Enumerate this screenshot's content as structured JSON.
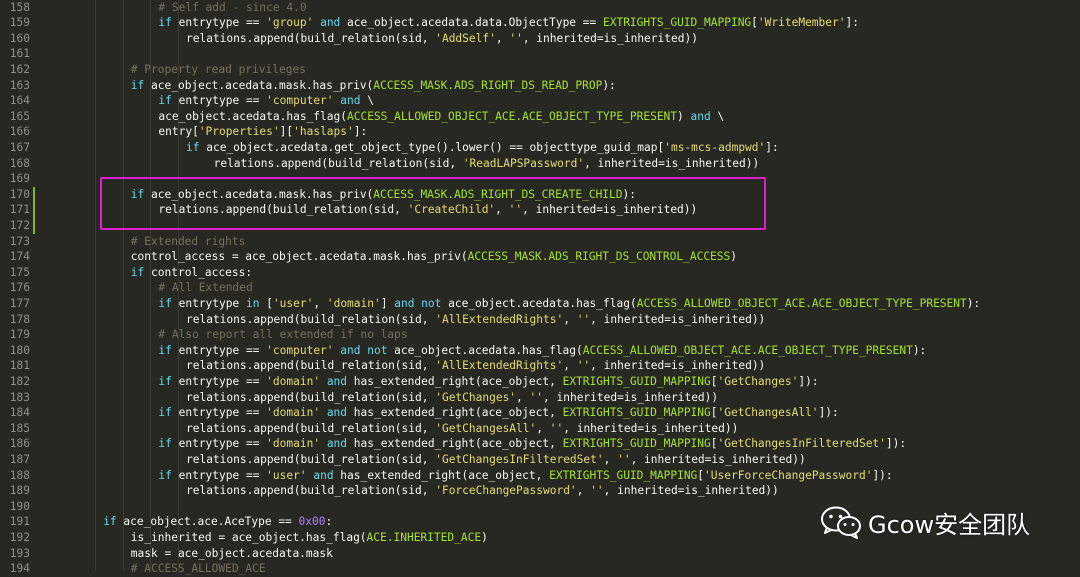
{
  "editor": {
    "lines": [
      {
        "n": "158",
        "i": 4,
        "t": [
          [
            "cm",
            "# Self add - since 4.0"
          ]
        ]
      },
      {
        "n": "159",
        "i": 4,
        "t": [
          [
            "kw",
            "if"
          ],
          [
            "pl",
            " entrytype == "
          ],
          [
            "st",
            "'group'"
          ],
          [
            "pl",
            " "
          ],
          [
            "kw",
            "and"
          ],
          [
            "pl",
            " ace_object.acedata.data.ObjectType == "
          ],
          [
            "cn",
            "EXTRIGHTS_GUID_MAPPING"
          ],
          [
            "pl",
            "["
          ],
          [
            "st",
            "'WriteMember'"
          ],
          [
            "pl",
            "]:"
          ]
        ]
      },
      {
        "n": "160",
        "i": 5,
        "t": [
          [
            "pl",
            "relations.append(build_relation(sid, "
          ],
          [
            "st",
            "'AddSelf'"
          ],
          [
            "pl",
            ", "
          ],
          [
            "st",
            "''"
          ],
          [
            "pl",
            ", inherited=is_inherited))"
          ]
        ]
      },
      {
        "n": "161",
        "i": 0,
        "t": []
      },
      {
        "n": "162",
        "i": 3,
        "t": [
          [
            "cm",
            "# Property read privileges"
          ]
        ]
      },
      {
        "n": "163",
        "i": 3,
        "t": [
          [
            "kw",
            "if"
          ],
          [
            "pl",
            " ace_object.acedata.mask.has_priv("
          ],
          [
            "cn",
            "ACCESS_MASK.ADS_RIGHT_DS_READ_PROP"
          ],
          [
            "pl",
            "):"
          ]
        ]
      },
      {
        "n": "164",
        "i": 4,
        "t": [
          [
            "kw",
            "if"
          ],
          [
            "pl",
            " entrytype == "
          ],
          [
            "st",
            "'computer'"
          ],
          [
            "pl",
            " "
          ],
          [
            "kw",
            "and"
          ],
          [
            "pl",
            " \\"
          ]
        ]
      },
      {
        "n": "165",
        "i": 4,
        "t": [
          [
            "pl",
            "ace_object.acedata.has_flag("
          ],
          [
            "cn",
            "ACCESS_ALLOWED_OBJECT_ACE.ACE_OBJECT_TYPE_PRESENT"
          ],
          [
            "pl",
            ") "
          ],
          [
            "kw",
            "and"
          ],
          [
            "pl",
            " \\"
          ]
        ]
      },
      {
        "n": "166",
        "i": 4,
        "t": [
          [
            "pl",
            "entry["
          ],
          [
            "st",
            "'Properties'"
          ],
          [
            "pl",
            "]["
          ],
          [
            "st",
            "'haslaps'"
          ],
          [
            "pl",
            "]:"
          ]
        ]
      },
      {
        "n": "167",
        "i": 5,
        "t": [
          [
            "kw",
            "if"
          ],
          [
            "pl",
            " ace_object.acedata.get_object_type().lower() == objecttype_guid_map["
          ],
          [
            "st",
            "'ms-mcs-admpwd'"
          ],
          [
            "pl",
            "]:"
          ]
        ]
      },
      {
        "n": "168",
        "i": 6,
        "t": [
          [
            "pl",
            "relations.append(build_relation(sid, "
          ],
          [
            "st",
            "'ReadLAPSPassword'"
          ],
          [
            "pl",
            ", inherited=is_inherited))"
          ]
        ]
      },
      {
        "n": "169",
        "i": 0,
        "t": []
      },
      {
        "n": "170",
        "i": 3,
        "t": [
          [
            "kw",
            "if"
          ],
          [
            "pl",
            " ace_object.acedata.mask.has_priv("
          ],
          [
            "cn",
            "ACCESS_MASK.ADS_RIGHT_DS_CREATE_CHILD"
          ],
          [
            "pl",
            "):"
          ]
        ]
      },
      {
        "n": "171",
        "i": 4,
        "t": [
          [
            "pl",
            "relations.append(build_relation(sid, "
          ],
          [
            "st",
            "'CreateChild'"
          ],
          [
            "pl",
            ", "
          ],
          [
            "st",
            "''"
          ],
          [
            "pl",
            ", inherited=is_inherited))"
          ]
        ]
      },
      {
        "n": "172",
        "i": 0,
        "t": []
      },
      {
        "n": "173",
        "i": 3,
        "t": [
          [
            "cm",
            "# Extended rights"
          ]
        ]
      },
      {
        "n": "174",
        "i": 3,
        "t": [
          [
            "pl",
            "control_access = ace_object.acedata.mask.has_priv("
          ],
          [
            "cn",
            "ACCESS_MASK.ADS_RIGHT_DS_CONTROL_ACCESS"
          ],
          [
            "pl",
            ")"
          ]
        ]
      },
      {
        "n": "175",
        "i": 3,
        "t": [
          [
            "kw",
            "if"
          ],
          [
            "pl",
            " control_access:"
          ]
        ]
      },
      {
        "n": "176",
        "i": 4,
        "t": [
          [
            "cm",
            "# All Extended"
          ]
        ]
      },
      {
        "n": "177",
        "i": 4,
        "t": [
          [
            "kw",
            "if"
          ],
          [
            "pl",
            " entrytype "
          ],
          [
            "kw",
            "in"
          ],
          [
            "pl",
            " ["
          ],
          [
            "st",
            "'user'"
          ],
          [
            "pl",
            ", "
          ],
          [
            "st",
            "'domain'"
          ],
          [
            "pl",
            "] "
          ],
          [
            "kw",
            "and not"
          ],
          [
            "pl",
            " ace_object.acedata.has_flag("
          ],
          [
            "cn",
            "ACCESS_ALLOWED_OBJECT_ACE.ACE_OBJECT_TYPE_PRESENT"
          ],
          [
            "pl",
            "):"
          ]
        ]
      },
      {
        "n": "178",
        "i": 5,
        "t": [
          [
            "pl",
            "relations.append(build_relation(sid, "
          ],
          [
            "st",
            "'AllExtendedRights'"
          ],
          [
            "pl",
            ", "
          ],
          [
            "st",
            "''"
          ],
          [
            "pl",
            ", inherited=is_inherited))"
          ]
        ]
      },
      {
        "n": "179",
        "i": 4,
        "t": [
          [
            "cm",
            "# Also report all extended if no laps"
          ]
        ]
      },
      {
        "n": "180",
        "i": 4,
        "t": [
          [
            "kw",
            "if"
          ],
          [
            "pl",
            " entrytype == "
          ],
          [
            "st",
            "'computer'"
          ],
          [
            "pl",
            " "
          ],
          [
            "kw",
            "and not"
          ],
          [
            "pl",
            " ace_object.acedata.has_flag("
          ],
          [
            "cn",
            "ACCESS_ALLOWED_OBJECT_ACE.ACE_OBJECT_TYPE_PRESENT"
          ],
          [
            "pl",
            "):"
          ]
        ]
      },
      {
        "n": "181",
        "i": 5,
        "t": [
          [
            "pl",
            "relations.append(build_relation(sid, "
          ],
          [
            "st",
            "'AllExtendedRights'"
          ],
          [
            "pl",
            ", "
          ],
          [
            "st",
            "''"
          ],
          [
            "pl",
            ", inherited=is_inherited))"
          ]
        ]
      },
      {
        "n": "182",
        "i": 4,
        "t": [
          [
            "kw",
            "if"
          ],
          [
            "pl",
            " entrytype == "
          ],
          [
            "st",
            "'domain'"
          ],
          [
            "pl",
            " "
          ],
          [
            "kw",
            "and"
          ],
          [
            "pl",
            " has_extended_right(ace_object, "
          ],
          [
            "cn",
            "EXTRIGHTS_GUID_MAPPING"
          ],
          [
            "pl",
            "["
          ],
          [
            "st",
            "'GetChanges'"
          ],
          [
            "pl",
            "]):"
          ]
        ]
      },
      {
        "n": "183",
        "i": 5,
        "t": [
          [
            "pl",
            "relations.append(build_relation(sid, "
          ],
          [
            "st",
            "'GetChanges'"
          ],
          [
            "pl",
            ", "
          ],
          [
            "st",
            "''"
          ],
          [
            "pl",
            ", inherited=is_inherited))"
          ]
        ]
      },
      {
        "n": "184",
        "i": 4,
        "t": [
          [
            "kw",
            "if"
          ],
          [
            "pl",
            " entrytype == "
          ],
          [
            "st",
            "'domain'"
          ],
          [
            "pl",
            " "
          ],
          [
            "kw",
            "and"
          ],
          [
            "pl",
            " has_extended_right(ace_object, "
          ],
          [
            "cn",
            "EXTRIGHTS_GUID_MAPPING"
          ],
          [
            "pl",
            "["
          ],
          [
            "st",
            "'GetChangesAll'"
          ],
          [
            "pl",
            "]):"
          ]
        ]
      },
      {
        "n": "185",
        "i": 5,
        "t": [
          [
            "pl",
            "relations.append(build_relation(sid, "
          ],
          [
            "st",
            "'GetChangesAll'"
          ],
          [
            "pl",
            ", "
          ],
          [
            "st",
            "''"
          ],
          [
            "pl",
            ", inherited=is_inherited))"
          ]
        ]
      },
      {
        "n": "186",
        "i": 4,
        "t": [
          [
            "kw",
            "if"
          ],
          [
            "pl",
            " entrytype == "
          ],
          [
            "st",
            "'domain'"
          ],
          [
            "pl",
            " "
          ],
          [
            "kw",
            "and"
          ],
          [
            "pl",
            " has_extended_right(ace_object, "
          ],
          [
            "cn",
            "EXTRIGHTS_GUID_MAPPING"
          ],
          [
            "pl",
            "["
          ],
          [
            "st",
            "'GetChangesInFilteredSet'"
          ],
          [
            "pl",
            "]):"
          ]
        ]
      },
      {
        "n": "187",
        "i": 5,
        "t": [
          [
            "pl",
            "relations.append(build_relation(sid, "
          ],
          [
            "st",
            "'GetChangesInFilteredSet'"
          ],
          [
            "pl",
            ", "
          ],
          [
            "st",
            "''"
          ],
          [
            "pl",
            ", inherited=is_inherited))"
          ]
        ]
      },
      {
        "n": "188",
        "i": 4,
        "t": [
          [
            "kw",
            "if"
          ],
          [
            "pl",
            " entrytype == "
          ],
          [
            "st",
            "'user'"
          ],
          [
            "pl",
            " "
          ],
          [
            "kw",
            "and"
          ],
          [
            "pl",
            " has_extended_right(ace_object, "
          ],
          [
            "cn",
            "EXTRIGHTS_GUID_MAPPING"
          ],
          [
            "pl",
            "["
          ],
          [
            "st",
            "'UserForceChangePassword'"
          ],
          [
            "pl",
            "]):"
          ]
        ]
      },
      {
        "n": "189",
        "i": 5,
        "t": [
          [
            "pl",
            "relations.append(build_relation(sid, "
          ],
          [
            "st",
            "'ForceChangePassword'"
          ],
          [
            "pl",
            ", "
          ],
          [
            "st",
            "''"
          ],
          [
            "pl",
            ", inherited=is_inherited))"
          ]
        ]
      },
      {
        "n": "190",
        "i": 0,
        "t": []
      },
      {
        "n": "191",
        "i": 2,
        "t": [
          [
            "kw",
            "if"
          ],
          [
            "pl",
            " ace_object.ace.AceType == "
          ],
          [
            "nm",
            "0x00"
          ],
          [
            "pl",
            ":"
          ]
        ]
      },
      {
        "n": "192",
        "i": 3,
        "t": [
          [
            "pl",
            "is_inherited = ace_object.has_flag("
          ],
          [
            "cn",
            "ACE.INHERITED_ACE"
          ],
          [
            "pl",
            ")"
          ]
        ]
      },
      {
        "n": "193",
        "i": 3,
        "t": [
          [
            "pl",
            "mask = ace_object.acedata.mask"
          ]
        ]
      },
      {
        "n": "194",
        "i": 3,
        "t": [
          [
            "cm",
            "# ACCESS_ALLOWED_ACE"
          ]
        ]
      }
    ]
  },
  "watermark": {
    "text": "Gcow安全团队",
    "icon": "wechat-icon"
  },
  "colors": {
    "background": "#272822",
    "comment": "#75715e",
    "keyword": "#66d9ef",
    "string": "#e6db74",
    "constant": "#a6e22e",
    "number": "#ae81ff",
    "highlight_box": "#e01fcf"
  }
}
